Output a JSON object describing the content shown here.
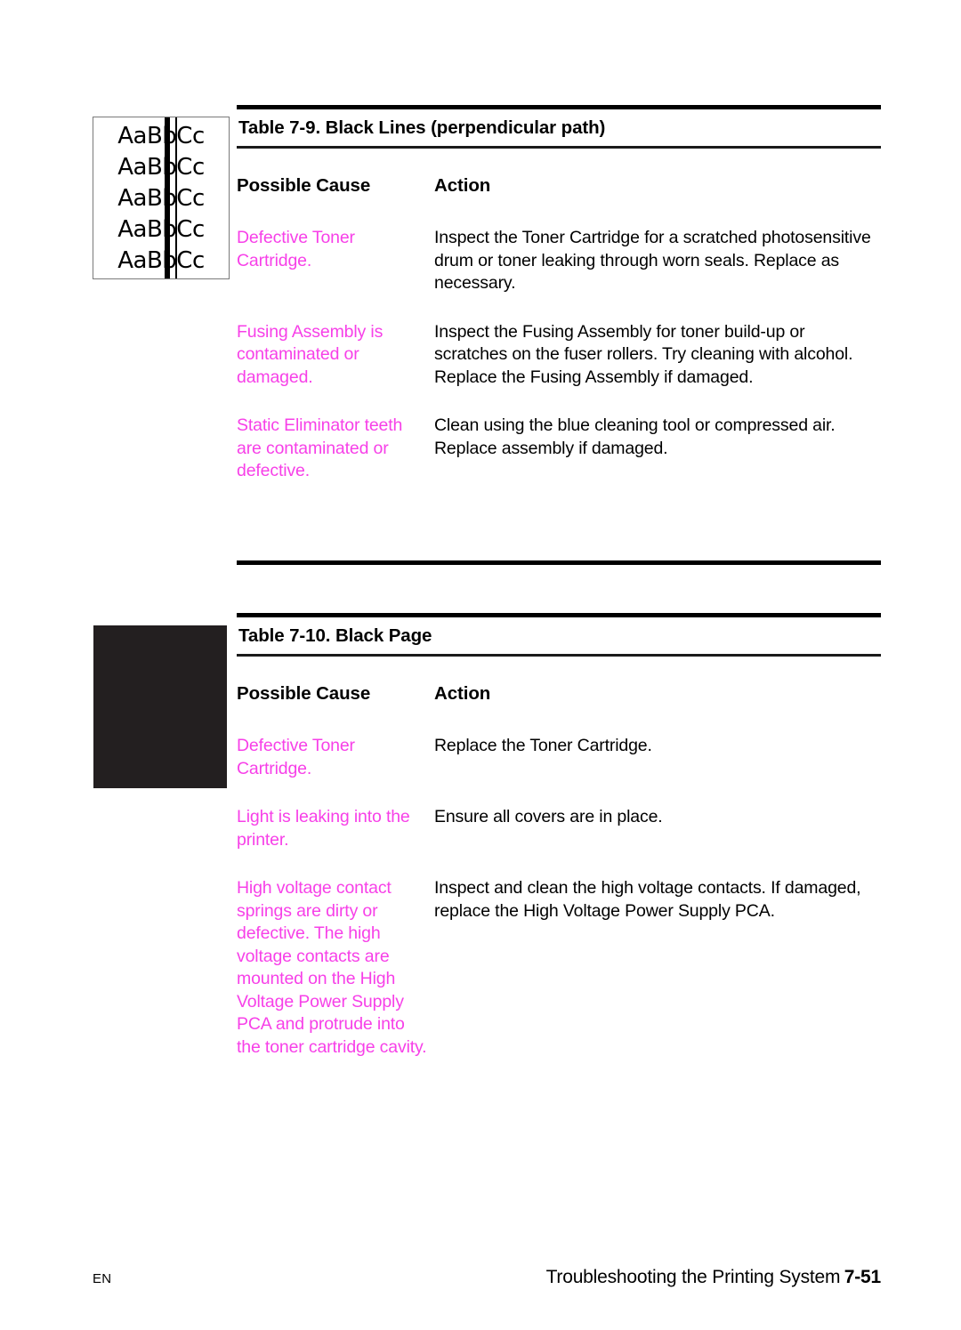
{
  "page": {
    "footer": {
      "language": "EN",
      "running_title": "Troubleshooting the Printing System",
      "page_number": "7-51"
    },
    "accent_color": "#f740e8",
    "text_color": "#000000",
    "black_sample_color": "#231f20"
  },
  "tables": [
    {
      "title": "Table 7-9. Black Lines (perpendicular path)",
      "columns": [
        "Possible Cause",
        "Action"
      ],
      "sample": {
        "type": "print-defect-sample",
        "kind": "black-lines",
        "text_lines": [
          "AaBbCc",
          "AaBbCc",
          "AaBbCc",
          "AaBbCc",
          "AaBbCc"
        ]
      },
      "rows": [
        {
          "cause": "Defective Toner Cartridge.",
          "action": "Inspect the Toner Cartridge for a scratched photosensitive drum or toner leaking through worn seals. Replace as necessary."
        },
        {
          "cause": "Fusing Assembly is contaminated or damaged.",
          "action": "Inspect the Fusing Assembly for toner build-up or scratches on the fuser rollers. Try cleaning with alcohol. Replace the Fusing Assembly if damaged."
        },
        {
          "cause": "Static Eliminator teeth are contaminated or defective.",
          "action": "Clean using the blue cleaning tool or compressed air. Replace assembly if damaged."
        }
      ]
    },
    {
      "title": "Table 7-10. Black Page",
      "columns": [
        "Possible Cause",
        "Action"
      ],
      "sample": {
        "type": "print-defect-sample",
        "kind": "black-page",
        "text_lines": []
      },
      "rows": [
        {
          "cause": "Defective Toner Cartridge.",
          "action": "Replace the Toner Cartridge."
        },
        {
          "cause": "Light is leaking into the printer.",
          "action": "Ensure all covers are in place."
        },
        {
          "cause": "High voltage contact springs are dirty or defective. The high voltage contacts are mounted on the High Voltage Power Supply PCA and protrude into the toner cartridge cavity.",
          "action": "Inspect and clean the high voltage contacts. If damaged, replace the High Voltage Power Supply PCA."
        }
      ]
    }
  ]
}
